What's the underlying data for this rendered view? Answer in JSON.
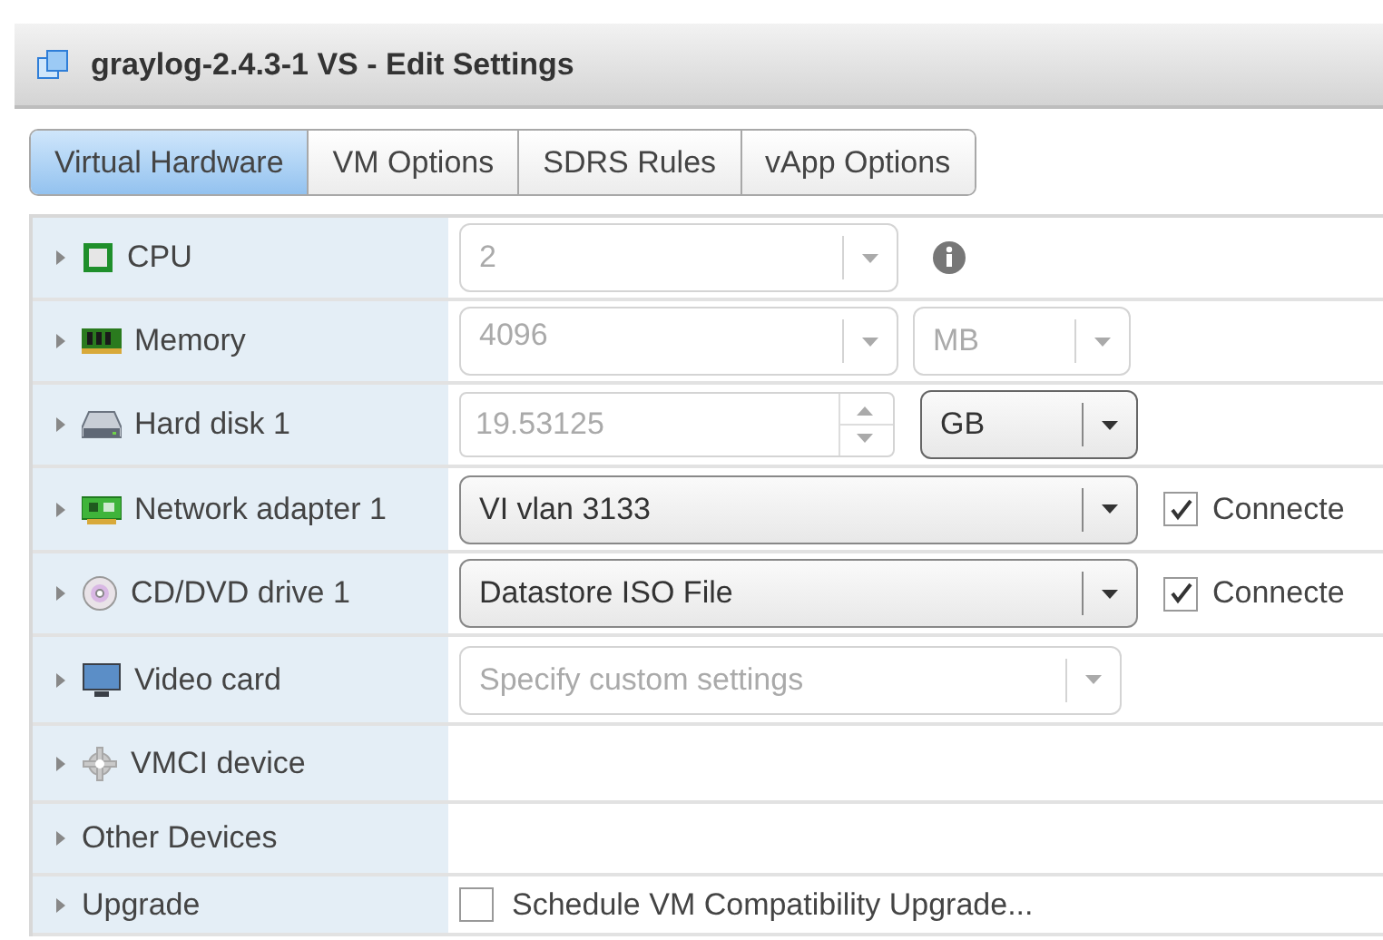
{
  "window": {
    "title": "graylog-2.4.3-1 VS - Edit Settings"
  },
  "tabs": [
    {
      "label": "Virtual Hardware",
      "selected": true
    },
    {
      "label": "VM Options",
      "selected": false
    },
    {
      "label": "SDRS Rules",
      "selected": false
    },
    {
      "label": "vApp Options",
      "selected": false
    }
  ],
  "rows": [
    {
      "label": "CPU",
      "expanded": false,
      "control": {
        "kind": "combo",
        "value": "2",
        "disabled": true
      },
      "info": true
    },
    {
      "label": "Memory",
      "expanded": false,
      "control": {
        "kind": "input-combo",
        "value": "4096",
        "disabled": true
      },
      "unit": {
        "value": "MB",
        "disabled": true
      }
    },
    {
      "label": "Hard disk 1",
      "expanded": false,
      "control": {
        "kind": "spinner",
        "value": "19.53125",
        "disabled": true
      },
      "unit": {
        "value": "GB",
        "disabled": false
      }
    },
    {
      "label": "Network adapter 1",
      "expanded": false,
      "control": {
        "kind": "select",
        "value": "VI vlan 3133",
        "disabled": false
      },
      "connected": {
        "label": "Connecte",
        "checked": true
      }
    },
    {
      "label": "CD/DVD drive 1",
      "expanded": false,
      "control": {
        "kind": "select",
        "value": "Datastore ISO File",
        "disabled": false
      },
      "connected": {
        "label": "Connecte",
        "checked": true
      }
    },
    {
      "label": "Video card",
      "expanded": false,
      "control": {
        "kind": "select",
        "placeholder": "Specify custom settings",
        "disabled": true
      }
    },
    {
      "label": "VMCI device",
      "expanded": false
    },
    {
      "label": "Other Devices",
      "expanded": false
    },
    {
      "label": "Upgrade",
      "expanded": false,
      "control": {
        "kind": "checkbox",
        "value": "Schedule VM Compatibility Upgrade...",
        "checked": false
      }
    }
  ]
}
